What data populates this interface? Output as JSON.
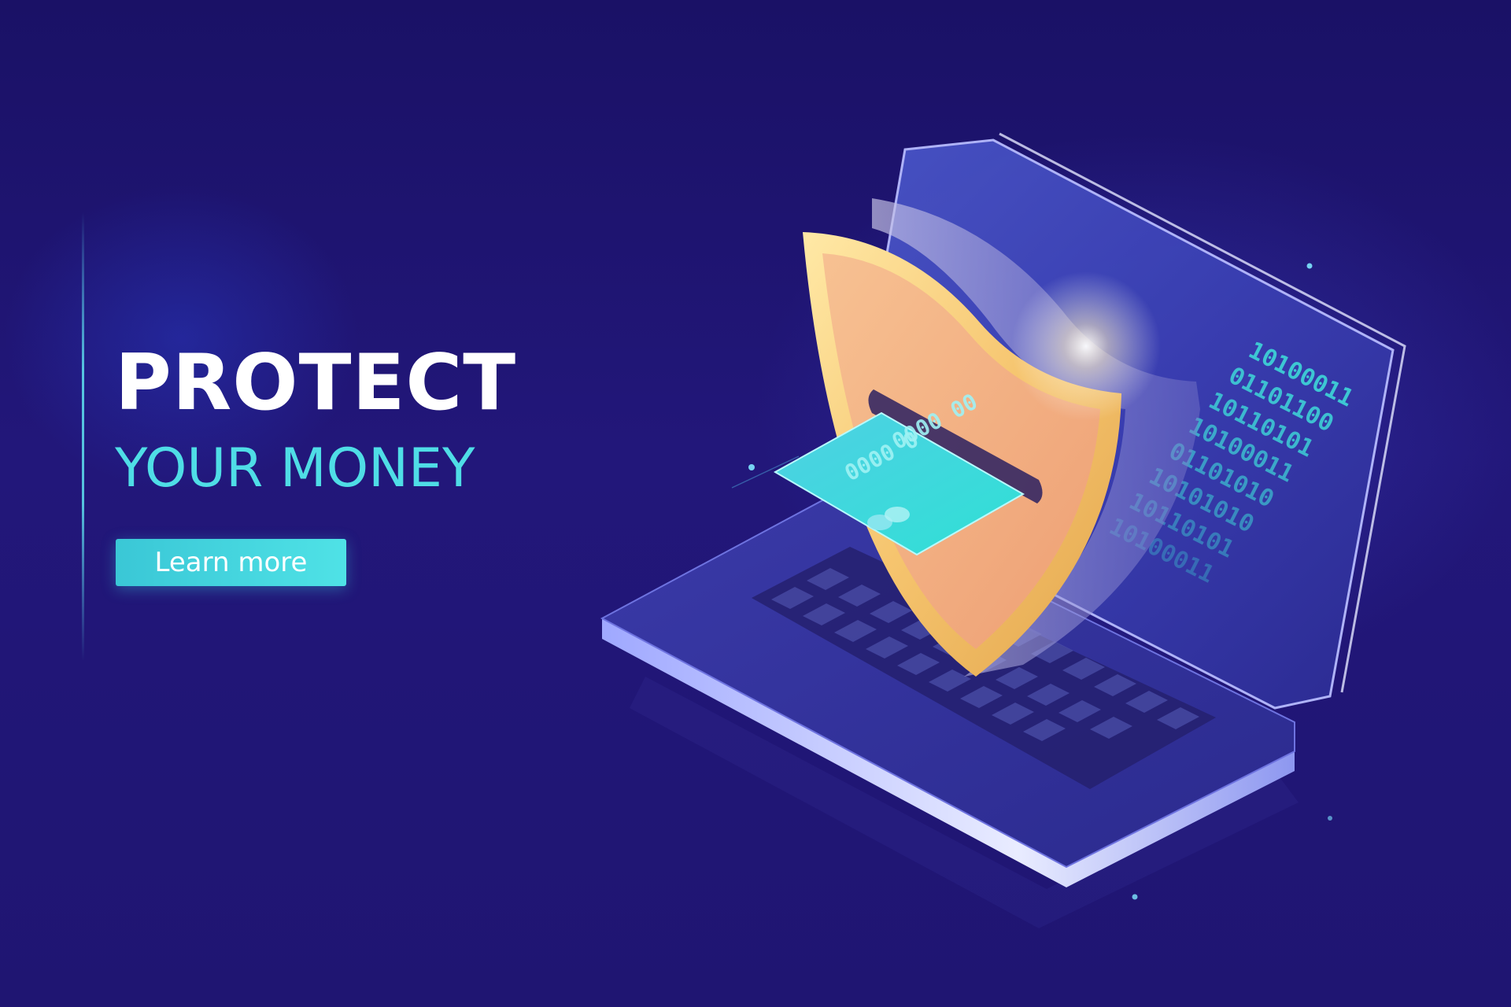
{
  "hero": {
    "title": "PROTECT",
    "subtitle": "YOUR MONEY",
    "button_label": "Learn more"
  },
  "card": {
    "number_group_1": "0000 00",
    "number_group_2": "0000 0"
  },
  "screen": {
    "binary_lines": [
      "10100011",
      "01101100",
      "10110101",
      "10100011",
      "01101010",
      "10101010",
      "10110101",
      "10100011"
    ]
  },
  "colors": {
    "background": "#1e1470",
    "accent_cyan": "#4fdde6",
    "shield_gold": "#f4c87a",
    "shield_face": "#f2ad80",
    "card_teal": "#3fd6dc"
  },
  "icons": [
    "shield-icon",
    "credit-card-icon",
    "laptop-icon"
  ]
}
